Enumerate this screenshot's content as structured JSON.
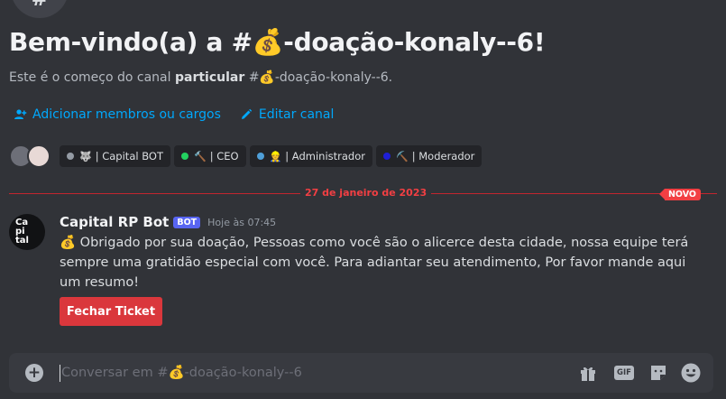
{
  "header": {
    "channel_icon": "#",
    "title": "Bem-vindo(a) a #💰-doação-konaly--6!",
    "subtitle_prefix": "Este é o começo do canal ",
    "subtitle_bold": "particular",
    "subtitle_suffix": " #💰-doação-konaly--6."
  },
  "actions": {
    "add_members": "Adicionar membros ou cargos",
    "edit_channel": "Editar canal"
  },
  "roles": [
    {
      "dot_color": "#949ba4",
      "icon": "🐺",
      "label": "| Capital BOT"
    },
    {
      "dot_color": "#23d160",
      "icon": "🔨",
      "label": "| CEO"
    },
    {
      "dot_color": "#4f9fd9",
      "icon": "👷",
      "label": "| Administrador"
    },
    {
      "dot_color": "#1f1fd6",
      "icon": "⛏️",
      "label": "| Moderador"
    }
  ],
  "divider": {
    "date": "27 de janeiro de 2023",
    "badge": "NOVO"
  },
  "message": {
    "avatar_text": "Ca pi tal",
    "author": "Capital RP Bot",
    "badge": "BOT",
    "timestamp": "Hoje às 07:45",
    "content": "💰 Obrigado por sua doação, Pessoas como você são o alicerce desta cidade, nossa equipe terá sempre uma gratidão especial com você. Para adiantar seu atendimento, Por favor mande aqui um resumo!",
    "button_label": "Fechar Ticket"
  },
  "composer": {
    "placeholder": "Conversar em #💰-doação-konaly--6",
    "gif_label": "GIF"
  },
  "colors": {
    "background": "#313338",
    "link": "#00a8fc",
    "danger": "#da373c",
    "divider": "#f23f43",
    "bot_badge": "#5865f2"
  }
}
